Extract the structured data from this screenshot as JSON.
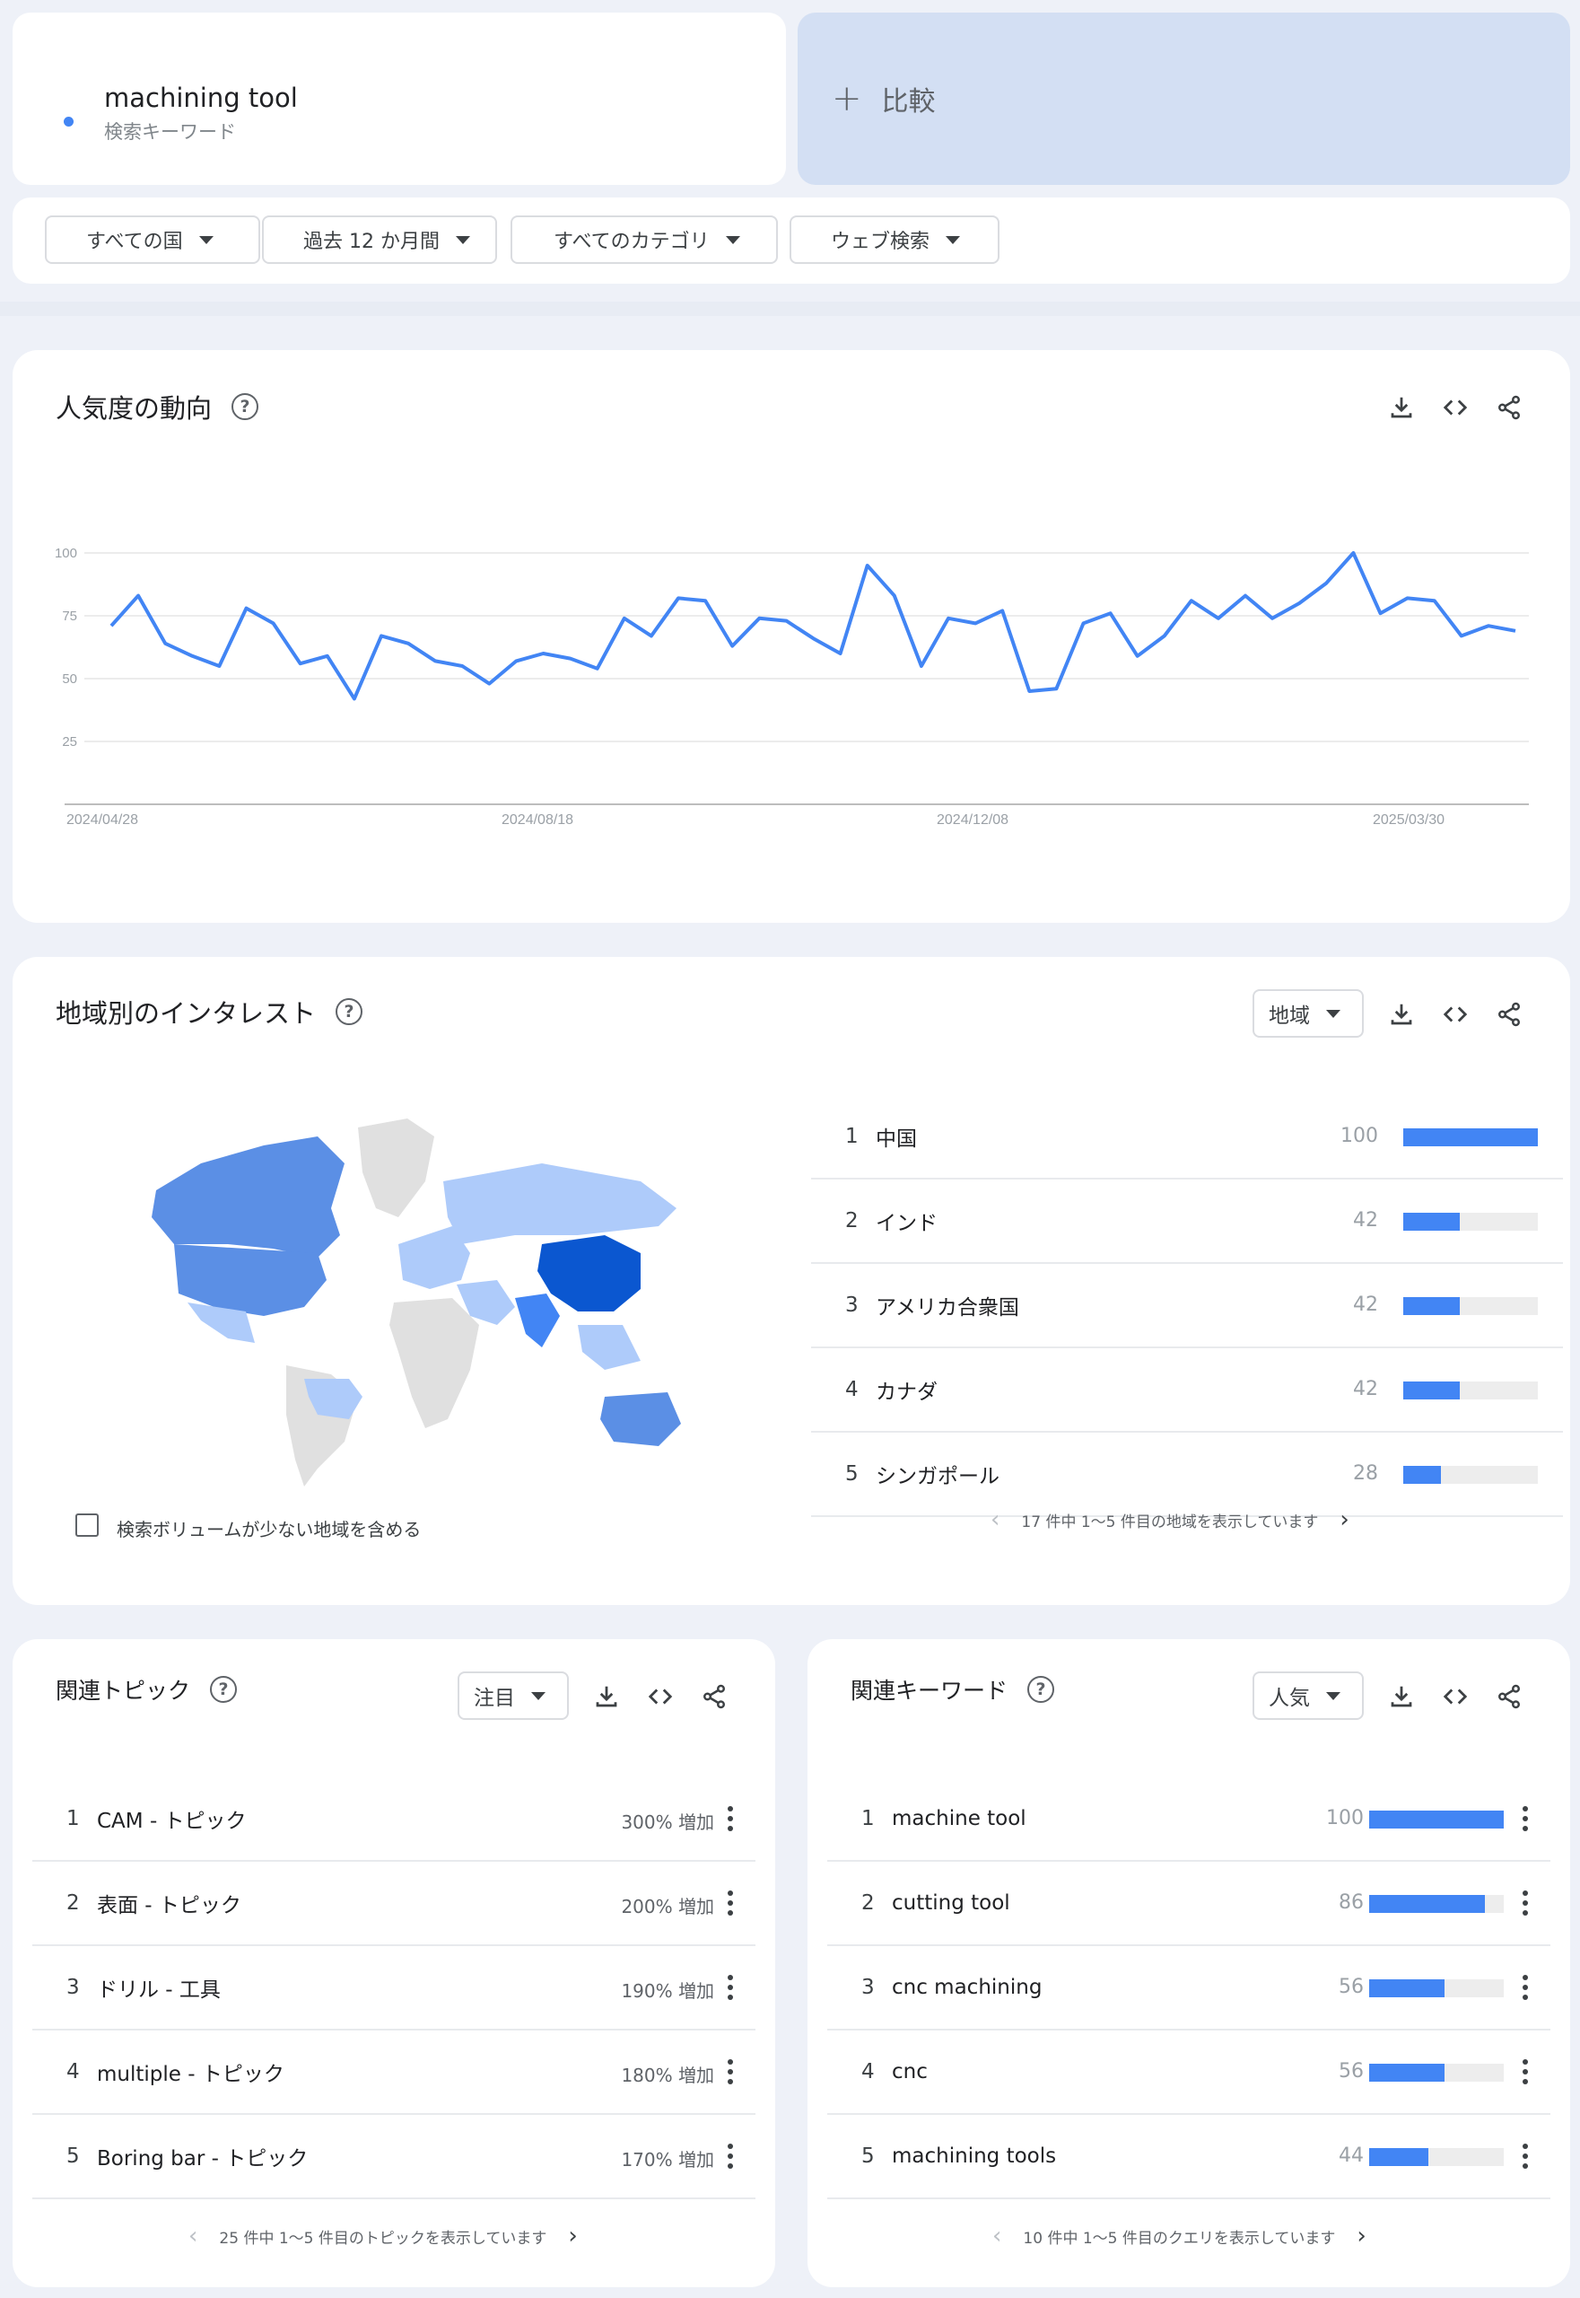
{
  "search": {
    "term": "machining tool",
    "term_type": "検索キーワード",
    "compare_label": "比較",
    "color": "#4285f4"
  },
  "filters": [
    {
      "label": "すべての国"
    },
    {
      "label": "過去 12 か月間"
    },
    {
      "label": "すべてのカテゴリ"
    },
    {
      "label": "ウェブ検索"
    }
  ],
  "trend": {
    "title": "人気度の動向",
    "icons": [
      "download-icon",
      "embed-icon",
      "share-icon"
    ]
  },
  "chart_data": {
    "type": "line",
    "ylim": [
      0,
      100
    ],
    "y_ticks": [
      "100",
      "75",
      "50",
      "25"
    ],
    "x_tick_labels": [
      "2024/04/28",
      "2024/08/18",
      "2024/12/08",
      "2025/03/30"
    ],
    "grid": true,
    "series": [
      {
        "color": "#4285f4",
        "values": [
          71,
          83,
          64,
          59,
          55,
          78,
          72,
          56,
          59,
          42,
          67,
          64,
          57,
          55,
          48,
          57,
          60,
          58,
          54,
          74,
          67,
          82,
          81,
          63,
          74,
          73,
          66,
          60,
          95,
          83,
          55,
          74,
          72,
          77,
          45,
          46,
          72,
          76,
          59,
          67,
          81,
          74,
          83,
          74,
          80,
          88,
          100,
          76,
          82,
          81,
          67,
          71,
          69
        ]
      }
    ]
  },
  "geo": {
    "title": "地域別のインタレスト",
    "resolution_label": "地域",
    "checkbox_label": "検索ボリュームが少ない地域を含める",
    "pager_text": "17 件中 1～5 件目の地域を表示しています",
    "rows": [
      {
        "rank": "1",
        "name": "中国",
        "value": 100
      },
      {
        "rank": "2",
        "name": "インド",
        "value": 42
      },
      {
        "rank": "3",
        "name": "アメリカ合衆国",
        "value": 42
      },
      {
        "rank": "4",
        "name": "カナダ",
        "value": 42
      },
      {
        "rank": "5",
        "name": "シンガポール",
        "value": 28
      }
    ]
  },
  "topics": {
    "title": "関連トピック",
    "mode_label": "注目",
    "pager_text": "25 件中 1～5 件目のトピックを表示しています",
    "rows": [
      {
        "rank": "1",
        "name": "CAM - トピック",
        "change": "300% 増加"
      },
      {
        "rank": "2",
        "name": "表面 - トピック",
        "change": "200% 増加"
      },
      {
        "rank": "3",
        "name": "ドリル - 工具",
        "change": "190% 増加"
      },
      {
        "rank": "4",
        "name": "multiple - トピック",
        "change": "180% 増加"
      },
      {
        "rank": "5",
        "name": "Boring bar - トピック",
        "change": "170% 増加"
      }
    ]
  },
  "queries": {
    "title": "関連キーワード",
    "mode_label": "人気",
    "pager_text": "10 件中 1～5 件目のクエリを表示しています",
    "rows": [
      {
        "rank": "1",
        "name": "machine tool",
        "value": 100
      },
      {
        "rank": "2",
        "name": "cutting tool",
        "value": 86
      },
      {
        "rank": "3",
        "name": "cnc machining",
        "value": 56
      },
      {
        "rank": "4",
        "name": "cnc",
        "value": 56
      },
      {
        "rank": "5",
        "name": "machining tools",
        "value": 44
      }
    ]
  }
}
